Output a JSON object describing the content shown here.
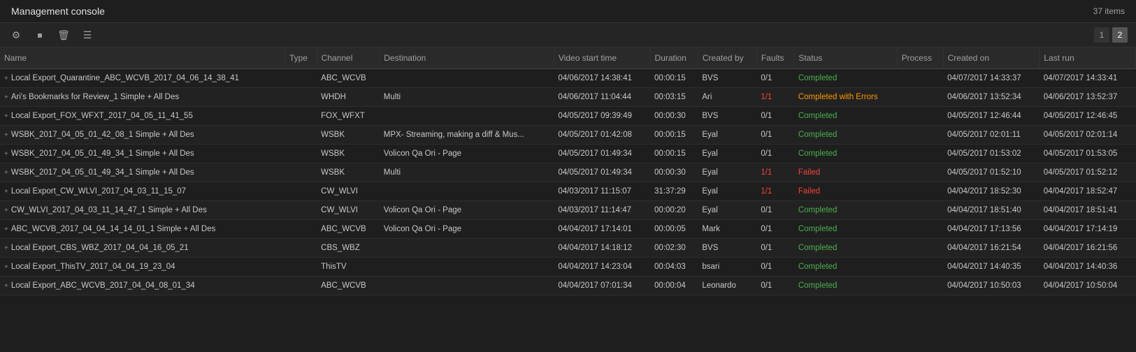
{
  "header": {
    "title": "Management console",
    "item_count": "37 items"
  },
  "toolbar": {
    "icons": [
      {
        "name": "settings-icon",
        "symbol": "⚙"
      },
      {
        "name": "stop-icon",
        "symbol": "⏹"
      },
      {
        "name": "delete-icon",
        "symbol": "🗑"
      },
      {
        "name": "list-icon",
        "symbol": "☰"
      }
    ],
    "pagination": {
      "pages": [
        "1",
        "2"
      ],
      "active": "2"
    }
  },
  "table": {
    "columns": [
      {
        "key": "name",
        "label": "Name"
      },
      {
        "key": "type",
        "label": "Type"
      },
      {
        "key": "channel",
        "label": "Channel"
      },
      {
        "key": "destination",
        "label": "Destination"
      },
      {
        "key": "video_start_time",
        "label": "Video start time"
      },
      {
        "key": "duration",
        "label": "Duration"
      },
      {
        "key": "created_by",
        "label": "Created by"
      },
      {
        "key": "faults",
        "label": "Faults"
      },
      {
        "key": "status",
        "label": "Status"
      },
      {
        "key": "process",
        "label": "Process"
      },
      {
        "key": "created_on",
        "label": "Created on"
      },
      {
        "key": "last_run",
        "label": "Last run"
      }
    ],
    "rows": [
      {
        "name": "Local Export_Quarantine_ABC_WCVB_2017_04_06_14_38_41",
        "type": "",
        "channel": "ABC_WCVB",
        "destination": "",
        "video_start_time": "04/06/2017 14:38:41",
        "duration": "00:00:15",
        "created_by": "BVS",
        "faults": "0/1",
        "faults_status": "normal",
        "status": "Completed",
        "status_class": "status-completed",
        "process": "",
        "created_on": "04/07/2017 14:33:37",
        "last_run": "04/07/2017 14:33:41"
      },
      {
        "name": "Ari's Bookmarks for Review_1 Simple + All Des",
        "type": "",
        "channel": "WHDH",
        "destination": "Multi",
        "video_start_time": "04/06/2017 11:04:44",
        "duration": "00:03:15",
        "created_by": "Ari",
        "faults": "1/1",
        "faults_status": "red",
        "status": "Completed with Errors",
        "status_class": "status-completed-errors",
        "process": "",
        "created_on": "04/06/2017 13:52:34",
        "last_run": "04/06/2017 13:52:37"
      },
      {
        "name": "Local Export_FOX_WFXT_2017_04_05_11_41_55",
        "type": "",
        "channel": "FOX_WFXT",
        "destination": "",
        "video_start_time": "04/05/2017 09:39:49",
        "duration": "00:00:30",
        "created_by": "BVS",
        "faults": "0/1",
        "faults_status": "normal",
        "status": "Completed",
        "status_class": "status-completed",
        "process": "",
        "created_on": "04/05/2017 12:46:44",
        "last_run": "04/05/2017 12:46:45"
      },
      {
        "name": "WSBK_2017_04_05_01_42_08_1 Simple + All Des",
        "type": "",
        "channel": "WSBK",
        "destination": "MPX- Streaming, making a diff & Mus...",
        "video_start_time": "04/05/2017 01:42:08",
        "duration": "00:00:15",
        "created_by": "Eyal",
        "faults": "0/1",
        "faults_status": "normal",
        "status": "Completed",
        "status_class": "status-completed",
        "process": "",
        "created_on": "04/05/2017 02:01:11",
        "last_run": "04/05/2017 02:01:14"
      },
      {
        "name": "WSBK_2017_04_05_01_49_34_1 Simple + All Des",
        "type": "",
        "channel": "WSBK",
        "destination": "Volicon Qa Ori - Page",
        "video_start_time": "04/05/2017 01:49:34",
        "duration": "00:00:15",
        "created_by": "Eyal",
        "faults": "0/1",
        "faults_status": "normal",
        "status": "Completed",
        "status_class": "status-completed",
        "process": "",
        "created_on": "04/05/2017 01:53:02",
        "last_run": "04/05/2017 01:53:05"
      },
      {
        "name": "WSBK_2017_04_05_01_49_34_1 Simple + All Des",
        "type": "",
        "channel": "WSBK",
        "destination": "Multi",
        "video_start_time": "04/05/2017 01:49:34",
        "duration": "00:00:30",
        "created_by": "Eyal",
        "faults": "1/1",
        "faults_status": "red",
        "status": "Failed",
        "status_class": "status-failed",
        "process": "",
        "created_on": "04/05/2017 01:52:10",
        "last_run": "04/05/2017 01:52:12"
      },
      {
        "name": "Local Export_CW_WLVI_2017_04_03_11_15_07",
        "type": "",
        "channel": "CW_WLVI",
        "destination": "",
        "video_start_time": "04/03/2017 11:15:07",
        "duration": "31:37:29",
        "created_by": "Eyal",
        "faults": "1/1",
        "faults_status": "red",
        "status": "Failed",
        "status_class": "status-failed",
        "process": "",
        "created_on": "04/04/2017 18:52:30",
        "last_run": "04/04/2017 18:52:47"
      },
      {
        "name": "CW_WLVI_2017_04_03_11_14_47_1 Simple + All Des",
        "type": "",
        "channel": "CW_WLVI",
        "destination": "Volicon Qa Ori - Page",
        "video_start_time": "04/03/2017 11:14:47",
        "duration": "00:00:20",
        "created_by": "Eyal",
        "faults": "0/1",
        "faults_status": "normal",
        "status": "Completed",
        "status_class": "status-completed",
        "process": "",
        "created_on": "04/04/2017 18:51:40",
        "last_run": "04/04/2017 18:51:41"
      },
      {
        "name": "ABC_WCVB_2017_04_04_14_14_01_1 Simple + All Des",
        "type": "",
        "channel": "ABC_WCVB",
        "destination": "Volicon Qa Ori - Page",
        "video_start_time": "04/04/2017 17:14:01",
        "duration": "00:00:05",
        "created_by": "Mark",
        "faults": "0/1",
        "faults_status": "normal",
        "status": "Completed",
        "status_class": "status-completed",
        "process": "",
        "created_on": "04/04/2017 17:13:56",
        "last_run": "04/04/2017 17:14:19"
      },
      {
        "name": "Local Export_CBS_WBZ_2017_04_04_16_05_21",
        "type": "",
        "channel": "CBS_WBZ",
        "destination": "",
        "video_start_time": "04/04/2017 14:18:12",
        "duration": "00:02:30",
        "created_by": "BVS",
        "faults": "0/1",
        "faults_status": "normal",
        "status": "Completed",
        "status_class": "status-completed",
        "process": "",
        "created_on": "04/04/2017 16:21:54",
        "last_run": "04/04/2017 16:21:56"
      },
      {
        "name": "Local Export_ThisTV_2017_04_04_19_23_04",
        "type": "",
        "channel": "ThisTV",
        "destination": "",
        "video_start_time": "04/04/2017 14:23:04",
        "duration": "00:04:03",
        "created_by": "bsari",
        "faults": "0/1",
        "faults_status": "normal",
        "status": "Completed",
        "status_class": "status-completed",
        "process": "",
        "created_on": "04/04/2017 14:40:35",
        "last_run": "04/04/2017 14:40:36"
      },
      {
        "name": "Local Export_ABC_WCVB_2017_04_04_08_01_34",
        "type": "",
        "channel": "ABC_WCVB",
        "destination": "",
        "video_start_time": "04/04/2017 07:01:34",
        "duration": "00:00:04",
        "created_by": "Leonardo",
        "faults": "0/1",
        "faults_status": "normal",
        "status": "Completed",
        "status_class": "status-completed",
        "process": "",
        "created_on": "04/04/2017 10:50:03",
        "last_run": "04/04/2017 10:50:04"
      }
    ]
  }
}
